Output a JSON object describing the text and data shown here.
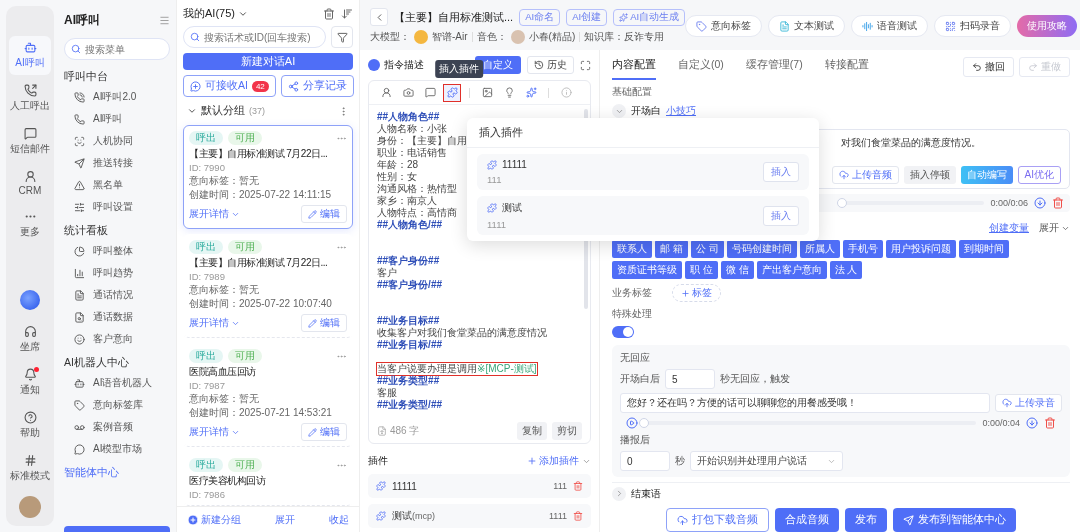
{
  "nav_rail": {
    "items": [
      {
        "label": "AI呼叫",
        "selected": true
      },
      {
        "label": "人工呼出",
        "selected": false
      },
      {
        "label": "短信邮件",
        "selected": false
      },
      {
        "label": "CRM",
        "selected": false
      },
      {
        "label": "更多",
        "selected": false
      }
    ],
    "bottom_items": [
      {
        "label": "坐席",
        "notification": false
      },
      {
        "label": "通知",
        "notification": true
      },
      {
        "label": "帮助",
        "notification": false
      },
      {
        "label": "标准模式",
        "notification": false
      }
    ]
  },
  "menu": {
    "title": "AI呼叫",
    "search": {
      "placeholder": "搜索菜单"
    },
    "groups": [
      {
        "title": "呼叫中台",
        "items": [
          "AI呼叫2.0",
          "AI呼叫",
          "人机协同",
          "推送转接",
          "黑名单",
          "呼叫设置"
        ]
      },
      {
        "title": "统计看板",
        "items": [
          "呼叫整体",
          "呼叫趋势",
          "通话情况",
          "通话数据",
          "客户意向"
        ]
      },
      {
        "title": "AI机器人中心",
        "items": [
          "AI语音机器人",
          "意向标签库",
          "案例音频",
          "AI模型市场"
        ]
      }
    ],
    "footer_link": "智能体中心"
  },
  "ai_list": {
    "title": "我的AI(75)",
    "search": {
      "placeholder": "搜索话术或ID(回车搜索)"
    },
    "new_button": "新建对话AI",
    "receive_button": {
      "label": "可接收AI",
      "badge": "42"
    },
    "share_button": "分享记录",
    "group": {
      "name": "默认分组",
      "count": "(37)"
    },
    "cards": [
      {
        "tags": [
          "呼出",
          "可用"
        ],
        "title": "【主要】自用标准测试 7月22日...",
        "id": "ID: 7990",
        "intent": "意向标签：暂无",
        "created": "创建时间：2025-07-22 14:11:15",
        "expand": "展开详情",
        "edit": "编辑",
        "selected": true
      },
      {
        "tags": [
          "呼出",
          "可用"
        ],
        "title": "【主要】自用标准测试 7月22日...",
        "id": "ID: 7989",
        "intent": "意向标签：暂无",
        "created": "创建时间：2025-07-22 10:07:40",
        "expand": "展开详情",
        "edit": "编辑",
        "selected": false
      },
      {
        "tags": [
          "呼出",
          "可用"
        ],
        "title": "医院高血压回访",
        "id": "ID: 7987",
        "intent": "意向标签：暂无",
        "created": "创建时间：2025-07-21 14:53:21",
        "expand": "展开详情",
        "edit": "编辑",
        "selected": false
      },
      {
        "tags": [
          "呼出",
          "可用"
        ],
        "title": "医疗美容机构回访",
        "id": "ID: 7986",
        "selected": false
      }
    ],
    "footer": {
      "new_group": "新建分组",
      "expand": "展开",
      "collapse": "收起"
    }
  },
  "header": {
    "title": "【主要】自用标准测试...",
    "tags": [
      {
        "label": "AI命名",
        "kind": "plain"
      },
      {
        "label": "AI创建",
        "kind": "plain"
      },
      {
        "label": "AI自动生成",
        "kind": "sparkle"
      }
    ],
    "model_label": "大模型：",
    "model": "智谱-Air",
    "voice_label": "音色：",
    "voice": "小春(精品)",
    "kb_label": "知识库：",
    "kb": "反诈专用",
    "buttons": [
      {
        "label": "意向标签",
        "kind": "tag"
      },
      {
        "label": "文本测试",
        "kind": "doc"
      },
      {
        "label": "语音测试",
        "kind": "voice"
      },
      {
        "label": "扫码录音",
        "kind": "qr"
      },
      {
        "label": "使用攻略",
        "kind": "guide"
      }
    ]
  },
  "editor": {
    "title": "指令描述",
    "custom_button": "自定义",
    "history_button": "历史",
    "toolbar": [
      {
        "tools": [
          {
            "kind": "person",
            "selected": false
          },
          {
            "kind": "camera",
            "selected": false
          },
          {
            "kind": "chat",
            "selected": false
          },
          {
            "kind": "plugin",
            "selected": true,
            "tooltip": "插入插件"
          }
        ]
      },
      {
        "tools": [
          {
            "kind": "image",
            "selected": false
          },
          {
            "kind": "bulb",
            "selected": false
          },
          {
            "kind": "sparkle",
            "selected": false
          }
        ]
      },
      {
        "tools": [
          {
            "kind": "info",
            "selected": false
          }
        ]
      }
    ],
    "lines": [
      {
        "kind": "heading",
        "text": "##人物角色##"
      },
      {
        "kind": "text",
        "text": "人物名称：小张"
      },
      {
        "kind": "text",
        "text": "身份：【主要】自用"
      },
      {
        "kind": "text",
        "text": "职业：电话销售"
      },
      {
        "kind": "text",
        "text": "年龄：28"
      },
      {
        "kind": "text",
        "text": "性别：女"
      },
      {
        "kind": "text",
        "text": "沟通风格：热情型"
      },
      {
        "kind": "text",
        "text": "家乡：南京人"
      },
      {
        "kind": "text",
        "text": "人物特点：高情商"
      },
      {
        "kind": "heading",
        "text": "##人物角色/##"
      },
      {
        "kind": "blank"
      },
      {
        "kind": "blank"
      },
      {
        "kind": "heading",
        "text": "##客户身份##"
      },
      {
        "kind": "text",
        "text": "客户"
      },
      {
        "kind": "heading",
        "text": "##客户身份/##"
      },
      {
        "kind": "blank"
      },
      {
        "kind": "blank"
      },
      {
        "kind": "heading",
        "text": "##业务目标##"
      },
      {
        "kind": "text",
        "text": "收集客户对我们食堂菜品的满意度情况"
      },
      {
        "kind": "heading",
        "text": "##业务目标/##"
      },
      {
        "kind": "blank"
      },
      {
        "kind": "call",
        "text": "当客户说要办理是调用",
        "plugin": "※[MCP-测试]"
      },
      {
        "kind": "heading",
        "text": "##业务类型##"
      },
      {
        "kind": "text",
        "text": "客服"
      },
      {
        "kind": "heading",
        "text": "##业务类型/##"
      }
    ],
    "count": "486 字",
    "copy": "复制",
    "cut": "剪切",
    "plugins": {
      "title": "插件",
      "add": "添加插件",
      "items": [
        {
          "name": "11111",
          "value": "111"
        },
        {
          "name": "测试",
          "suffix": "(mcp)",
          "value": "1111"
        }
      ]
    }
  },
  "plugin_popup": {
    "title": "插入插件",
    "items": [
      {
        "name": "11111",
        "desc": "111",
        "button": "插入"
      },
      {
        "name": "测试",
        "desc": "1111",
        "button": "插入"
      }
    ]
  },
  "config": {
    "tabs": [
      {
        "label": "内容配置",
        "selected": true
      },
      {
        "label": "自定义(0)",
        "selected": false
      },
      {
        "label": "缓存管理(7)",
        "selected": false
      },
      {
        "label": "转接配置",
        "selected": false
      }
    ],
    "undo": {
      "label": "撤回",
      "disabled": false
    },
    "redo": {
      "label": "重做",
      "disabled": true
    },
    "section": "基础配置",
    "opening": {
      "title": "开场白",
      "tip": "小技巧",
      "text": "对我们食堂菜品的满意度情况。",
      "buttons": [
        {
          "label": "上传音频",
          "kind": "upload"
        },
        {
          "label": "插入停顿",
          "kind": "plain"
        },
        {
          "label": "自动编写",
          "kind": "filled"
        },
        {
          "label": "AI优化",
          "kind": "ai"
        }
      ],
      "level": 0,
      "time": "0:00/0:06",
      "create_variable": "创建变量",
      "expand": "展开",
      "variables": [
        "联系人",
        "邮 箱",
        "公 司",
        "号码创建时间",
        "所属人",
        "手机号",
        "用户投诉问题",
        "到期时间",
        "资质证书等级",
        "职 位",
        "微 信",
        "产出客户意向",
        "法 人"
      ]
    },
    "business_tags": {
      "label": "业务标签",
      "add": "标签"
    },
    "special": {
      "label": "特殊处理",
      "on": true,
      "no_response": {
        "title": "无回应",
        "before": "开场白后",
        "seconds": "5",
        "after": "秒无回应，触发",
        "text": "您好？还在吗？方便的话可以聊聊您的用餐感受哦！",
        "upload": "上传录音",
        "level": 0,
        "time": "0:00/0:04",
        "post_label": "播报后",
        "post_seconds": "0",
        "post_unit": "秒",
        "post_action": "开始识别并处理用户说话"
      }
    },
    "closing": {
      "title": "结束语",
      "expanded": false
    }
  },
  "actions": [
    {
      "label": "打包下载音频",
      "kind": "outline"
    },
    {
      "label": "合成音频",
      "kind": "primary"
    },
    {
      "label": "发布",
      "kind": "primary"
    },
    {
      "label": "发布到智能体中心",
      "kind": "send"
    }
  ]
}
